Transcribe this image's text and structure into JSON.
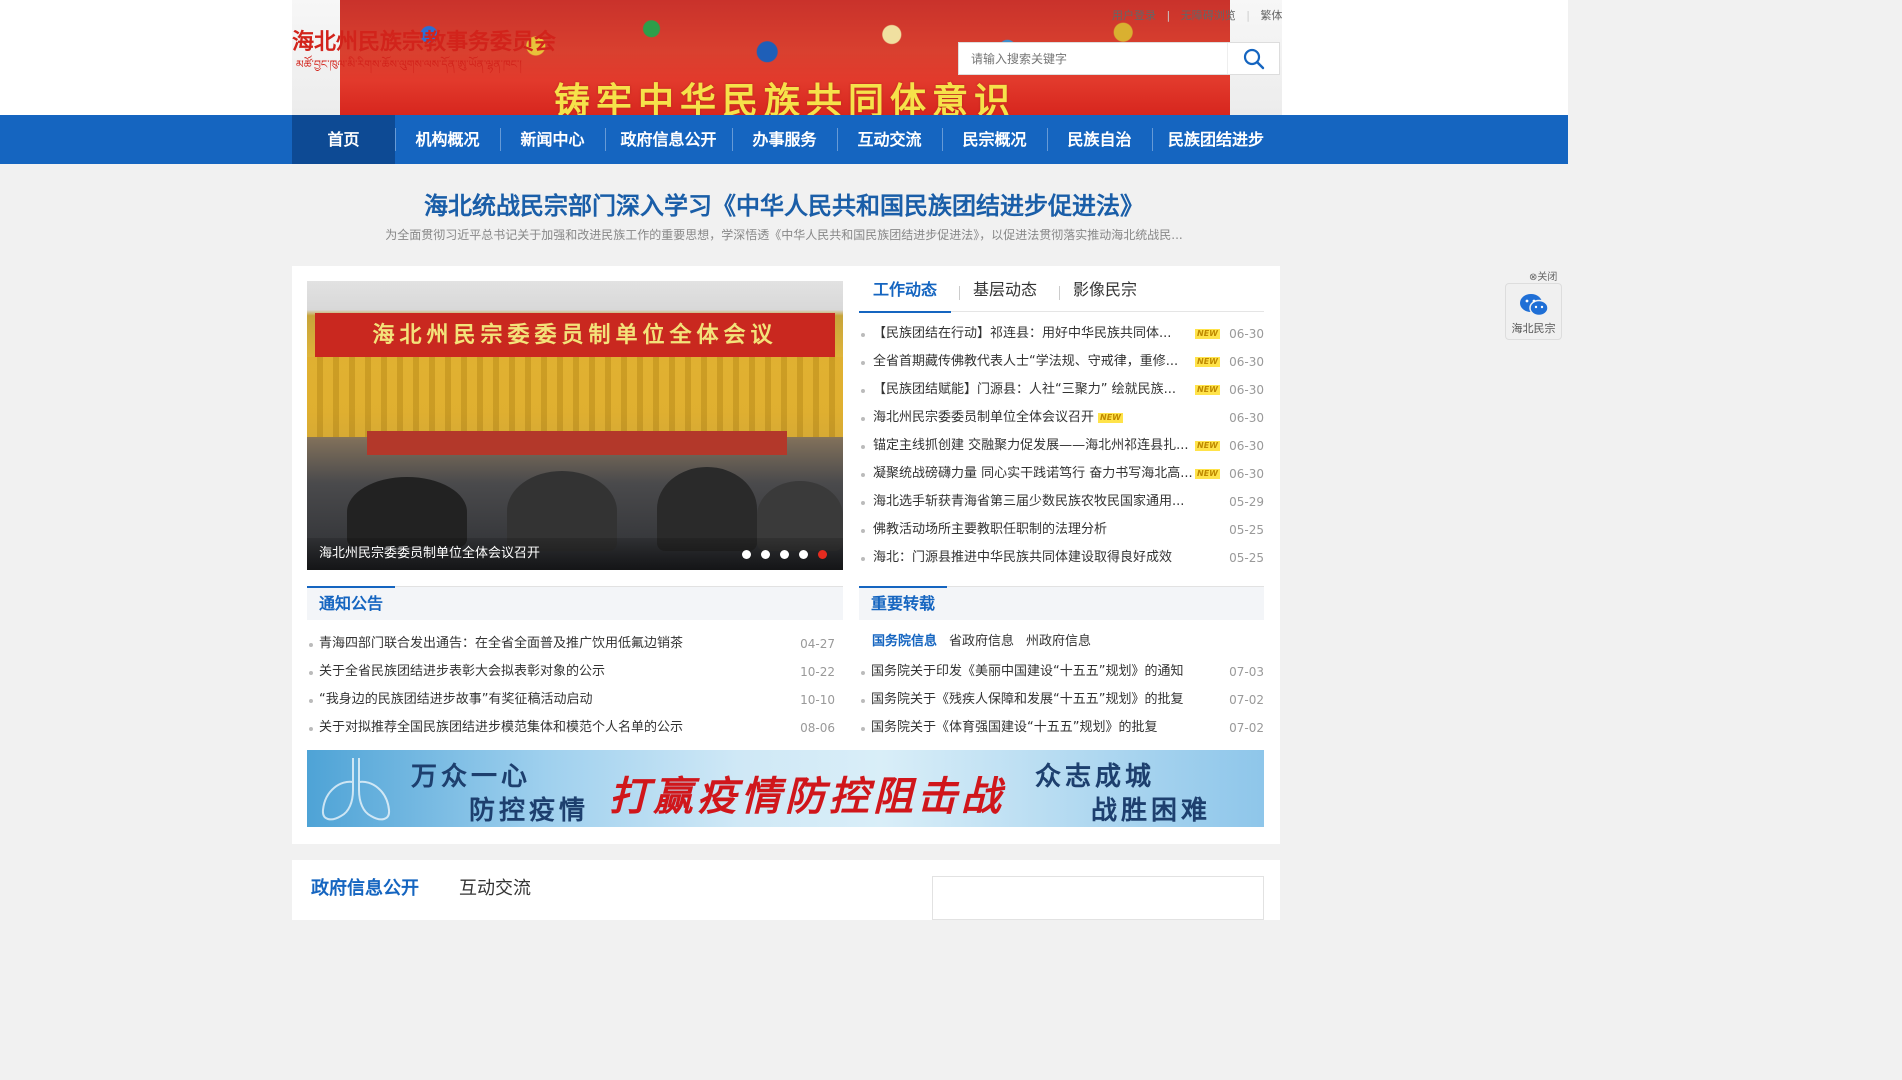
{
  "header": {
    "logo_cn": "海北州民族宗教事务委员会",
    "logo_tibetan": "མཚོ་བྱང་ཁུལ་མི་རིགས་ཆོས་ལུགས་ལས་དོན་ཨུ་ཡོན་ལྷན་ཁང་།",
    "banner_slogan": "铸牢中华民族共同体意识",
    "top_links": [
      "用户登录",
      "无障碍浏览",
      "繁体"
    ],
    "search_placeholder": "请输入搜索关键字"
  },
  "nav": {
    "items": [
      "首页",
      "机构概况",
      "新闻中心",
      "政府信息公开",
      "办事服务",
      "互动交流",
      "民宗概况",
      "民族自治",
      "民族团结进步"
    ],
    "active_index": 0
  },
  "headline": {
    "title": "海北统战民宗部门深入学习《中华人民共和国民族团结进步促进法》",
    "summary": "为全面贯彻习近平总书记关于加强和改进民族工作的重要思想，学深悟透《中华人民共和国民族团结进步促进法》，以促进法贯彻落实推动海北统战民..."
  },
  "slider": {
    "banner_text": "海北州民宗委委员制单位全体会议",
    "caption": "海北州民宗委委员制单位全体会议召开",
    "dot_count": 5,
    "active_dot": 4
  },
  "news": {
    "tabs": [
      "工作动态",
      "基层动态",
      "影像民宗"
    ],
    "active_tab": 0,
    "new_badge": "NEW",
    "items": [
      {
        "title": "【民族团结在行动】祁连县：用好中华民族共同体...",
        "date": "06-30",
        "is_new": true
      },
      {
        "title": "全省首期藏传佛教代表人士“学法规、守戒律，重修...",
        "date": "06-30",
        "is_new": true
      },
      {
        "title": "【民族团结赋能】门源县：人社“三聚力” 绘就民族...",
        "date": "06-30",
        "is_new": true
      },
      {
        "title": "海北州民宗委委员制单位全体会议召开",
        "date": "06-30",
        "is_new": true,
        "badge_inline": true
      },
      {
        "title": "锚定主线抓创建 交融聚力促发展——海北州祁连县扎...",
        "date": "06-30",
        "is_new": true
      },
      {
        "title": "凝聚统战磅礴力量 同心实干践诺笃行 奋力书写海北高...",
        "date": "06-30",
        "is_new": true
      },
      {
        "title": "海北选手斩获青海省第三届少数民族农牧民国家通用...",
        "date": "05-29",
        "is_new": false
      },
      {
        "title": "佛教活动场所主要教职任职制的法理分析",
        "date": "05-25",
        "is_new": false
      },
      {
        "title": "海北：门源县推进中华民族共同体建设取得良好成效",
        "date": "05-25",
        "is_new": false
      }
    ]
  },
  "notices": {
    "title": "通知公告",
    "items": [
      {
        "title": "青海四部门联合发出通告：在全省全面普及推广饮用低氟边销茶",
        "date": "04-27"
      },
      {
        "title": "关于全省民族团结进步表彰大会拟表彰对象的公示",
        "date": "10-22"
      },
      {
        "title": "“我身边的民族团结进步故事”有奖征稿活动启动",
        "date": "10-10"
      },
      {
        "title": "关于对拟推荐全国民族团结进步模范集体和模范个人名单的公示",
        "date": "08-06"
      }
    ]
  },
  "reposts": {
    "title": "重要转载",
    "subtabs": [
      "国务院信息",
      "省政府信息",
      "州政府信息"
    ],
    "active_subtab": 0,
    "items": [
      {
        "title": "国务院关于印发《美丽中国建设“十五五”规划》的通知",
        "date": "07-03"
      },
      {
        "title": "国务院关于《残疾人保障和发展“十五五”规划》的批复",
        "date": "07-02"
      },
      {
        "title": "国务院关于《体育强国建设“十五五”规划》的批复",
        "date": "07-02"
      }
    ]
  },
  "epidemic_banner": {
    "left_line1": "万众一心",
    "left_line2": "防控疫情",
    "center": "打赢疫情防控阻击战",
    "right_line1": "众志成城",
    "right_line2": "战胜困难"
  },
  "lower": {
    "tabs": [
      "政府信息公开",
      "互动交流"
    ],
    "active_tab": 0
  },
  "float": {
    "close_label": "⊗关闭",
    "wechat_label": "海北民宗"
  },
  "colors": {
    "nav_blue": "#1565c0",
    "nav_active": "#0d4a94",
    "headline_blue": "#1a5ea8",
    "logo_red": "#d2231b",
    "new_badge": "#ffe34a"
  }
}
